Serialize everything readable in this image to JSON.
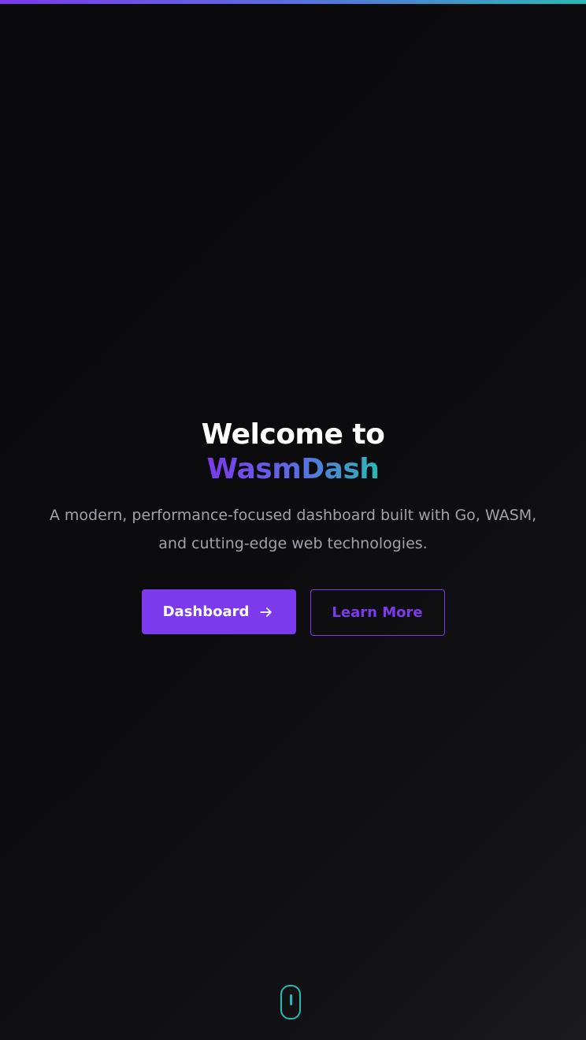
{
  "hero": {
    "title_line1": "Welcome to",
    "brand_name": "WasmDash",
    "subtitle": "A modern, performance-focused dashboard built with Go, WASM, and cutting-edge web technologies."
  },
  "actions": {
    "primary_label": "Dashboard",
    "primary_icon": "arrow-right-icon",
    "secondary_label": "Learn More"
  },
  "scroll_indicator": {
    "icon": "mouse-scroll-icon"
  },
  "colors": {
    "background": "#0b0b0d",
    "accent_purple": "#7c3aed",
    "accent_blue": "#5a6fe0",
    "accent_teal": "#2bb8b5",
    "text_primary": "#ffffff",
    "text_muted": "#a1a1aa"
  }
}
